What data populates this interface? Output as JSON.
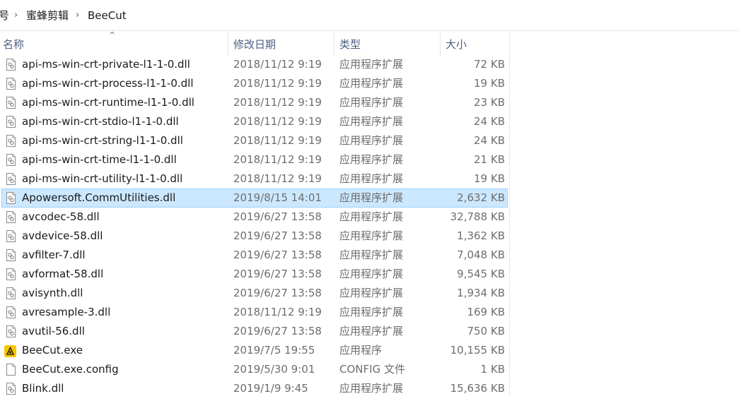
{
  "breadcrumb": {
    "prev_fragment": "号",
    "parent": "蜜蜂剪辑",
    "current": "BeeCut",
    "separator": "›"
  },
  "columns": {
    "name": "名称",
    "date": "修改日期",
    "type": "类型",
    "size": "大小"
  },
  "files": [
    {
      "name": "api-ms-win-crt-private-l1-1-0.dll",
      "date": "2018/11/12 9:19",
      "type": "应用程序扩展",
      "size": "72 KB",
      "icon": "dll-file-icon"
    },
    {
      "name": "api-ms-win-crt-process-l1-1-0.dll",
      "date": "2018/11/12 9:19",
      "type": "应用程序扩展",
      "size": "19 KB",
      "icon": "dll-file-icon"
    },
    {
      "name": "api-ms-win-crt-runtime-l1-1-0.dll",
      "date": "2018/11/12 9:19",
      "type": "应用程序扩展",
      "size": "23 KB",
      "icon": "dll-file-icon"
    },
    {
      "name": "api-ms-win-crt-stdio-l1-1-0.dll",
      "date": "2018/11/12 9:19",
      "type": "应用程序扩展",
      "size": "24 KB",
      "icon": "dll-file-icon"
    },
    {
      "name": "api-ms-win-crt-string-l1-1-0.dll",
      "date": "2018/11/12 9:19",
      "type": "应用程序扩展",
      "size": "24 KB",
      "icon": "dll-file-icon"
    },
    {
      "name": "api-ms-win-crt-time-l1-1-0.dll",
      "date": "2018/11/12 9:19",
      "type": "应用程序扩展",
      "size": "21 KB",
      "icon": "dll-file-icon"
    },
    {
      "name": "api-ms-win-crt-utility-l1-1-0.dll",
      "date": "2018/11/12 9:19",
      "type": "应用程序扩展",
      "size": "19 KB",
      "icon": "dll-file-icon"
    },
    {
      "name": "Apowersoft.CommUtilities.dll",
      "date": "2019/8/15 14:01",
      "type": "应用程序扩展",
      "size": "2,632 KB",
      "icon": "dll-file-icon",
      "selected": true
    },
    {
      "name": "avcodec-58.dll",
      "date": "2019/6/27 13:58",
      "type": "应用程序扩展",
      "size": "32,788 KB",
      "icon": "dll-file-icon"
    },
    {
      "name": "avdevice-58.dll",
      "date": "2019/6/27 13:58",
      "type": "应用程序扩展",
      "size": "1,362 KB",
      "icon": "dll-file-icon"
    },
    {
      "name": "avfilter-7.dll",
      "date": "2019/6/27 13:58",
      "type": "应用程序扩展",
      "size": "7,048 KB",
      "icon": "dll-file-icon"
    },
    {
      "name": "avformat-58.dll",
      "date": "2019/6/27 13:58",
      "type": "应用程序扩展",
      "size": "9,545 KB",
      "icon": "dll-file-icon"
    },
    {
      "name": "avisynth.dll",
      "date": "2019/6/27 13:58",
      "type": "应用程序扩展",
      "size": "1,934 KB",
      "icon": "dll-file-icon"
    },
    {
      "name": "avresample-3.dll",
      "date": "2018/11/12 9:19",
      "type": "应用程序扩展",
      "size": "169 KB",
      "icon": "dll-file-icon"
    },
    {
      "name": "avutil-56.dll",
      "date": "2019/6/27 13:58",
      "type": "应用程序扩展",
      "size": "750 KB",
      "icon": "dll-file-icon"
    },
    {
      "name": "BeeCut.exe",
      "date": "2019/7/5 19:55",
      "type": "应用程序",
      "size": "10,155 KB",
      "icon": "beecut-app-icon"
    },
    {
      "name": "BeeCut.exe.config",
      "date": "2019/5/30 9:01",
      "type": "CONFIG 文件",
      "size": "1 KB",
      "icon": "blank-file-icon"
    },
    {
      "name": "Blink.dll",
      "date": "2019/1/9 9:45",
      "type": "应用程序扩展",
      "size": "15,636 KB",
      "icon": "dll-file-icon"
    }
  ]
}
